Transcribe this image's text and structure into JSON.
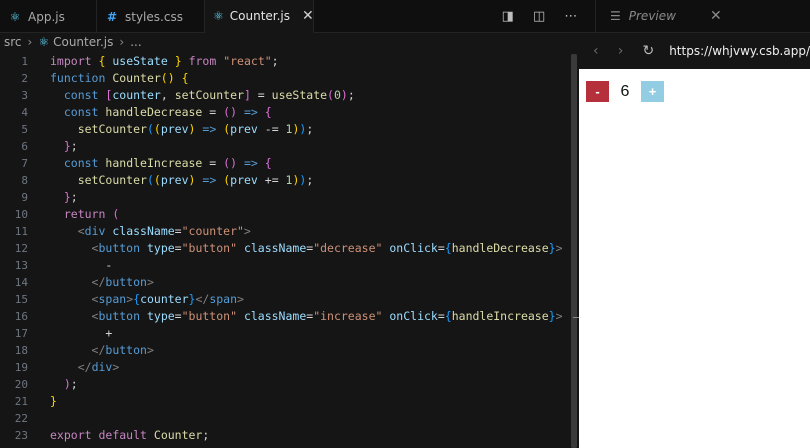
{
  "tabs": [
    {
      "label": "App.js",
      "icon": "react-icon"
    },
    {
      "label": "styles.css",
      "icon": "hash-icon"
    },
    {
      "label": "Counter.js",
      "icon": "react-icon",
      "active": true
    }
  ],
  "preview_tab": {
    "label": "Preview"
  },
  "breadcrumb": {
    "folder": "src",
    "file": "Counter.js",
    "more": "..."
  },
  "editor": {
    "line_numbers": [
      "1",
      "2",
      "3",
      "4",
      "5",
      "6",
      "7",
      "8",
      "9",
      "10",
      "11",
      "12",
      "13",
      "14",
      "15",
      "16",
      "17",
      "18",
      "19",
      "20",
      "21",
      "22",
      "23"
    ]
  },
  "preview": {
    "url": "https://whjvwy.csb.app/",
    "decrease_label": "-",
    "count": "6",
    "increase_label": "+"
  },
  "colors": {
    "decrease": "#b5303b",
    "increase": "#92cde4",
    "react": "#61dafb"
  }
}
